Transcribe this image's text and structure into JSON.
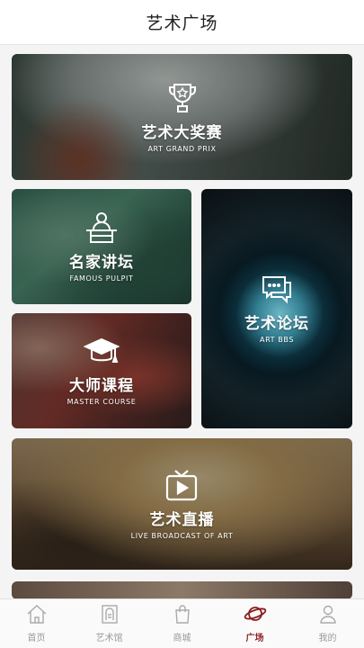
{
  "header": {
    "title": "艺术广场"
  },
  "cards": {
    "grand_prix": {
      "title": "艺术大奖赛",
      "subtitle": "ART GRAND PRIX",
      "icon": "trophy-icon"
    },
    "pulpit": {
      "title": "名家讲坛",
      "subtitle": "FAMOUS  PULPIT",
      "icon": "lectern-speaker-icon"
    },
    "bbs": {
      "title": "艺术论坛",
      "subtitle": "ART  BBS",
      "icon": "chat-bubbles-icon"
    },
    "master": {
      "title": "大师课程",
      "subtitle": "MASTER COURSE",
      "icon": "graduation-cap-icon"
    },
    "live": {
      "title": "艺术直播",
      "subtitle": "LIVE BROADCAST OF ART",
      "icon": "tv-play-icon"
    }
  },
  "tabbar": {
    "items": [
      {
        "label": "首页",
        "icon": "home-icon"
      },
      {
        "label": "艺术馆",
        "icon": "gallery-icon"
      },
      {
        "label": "商城",
        "icon": "shopping-bag-icon"
      },
      {
        "label": "广场",
        "icon": "planet-icon",
        "active": true
      },
      {
        "label": "我的",
        "icon": "user-icon"
      }
    ],
    "active_color": "#8b1e1e",
    "inactive_color": "#999999"
  }
}
